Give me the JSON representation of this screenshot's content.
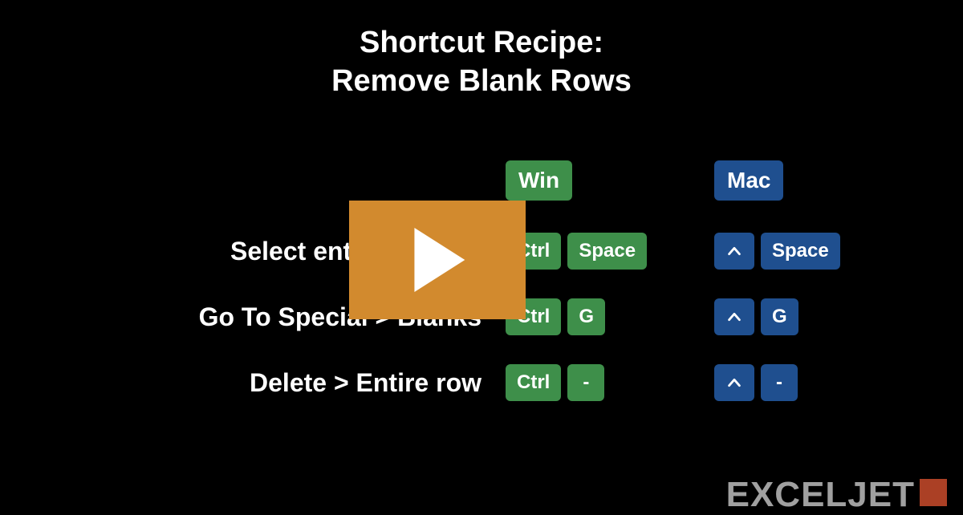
{
  "title_line1": "Shortcut Recipe:",
  "title_line2": "Remove Blank Rows",
  "headers": {
    "win": "Win",
    "mac": "Mac"
  },
  "rows": [
    {
      "label": "Select entire column",
      "win": [
        "Ctrl",
        "Space"
      ],
      "mac": [
        "^",
        "Space"
      ]
    },
    {
      "label": "Go To Special > Blanks",
      "win": [
        "Ctrl",
        "G"
      ],
      "mac": [
        "^",
        "G"
      ]
    },
    {
      "label": "Delete > Entire row",
      "win": [
        "Ctrl",
        "-"
      ],
      "mac": [
        "^",
        "-"
      ]
    }
  ],
  "logo": "EXCELJET"
}
